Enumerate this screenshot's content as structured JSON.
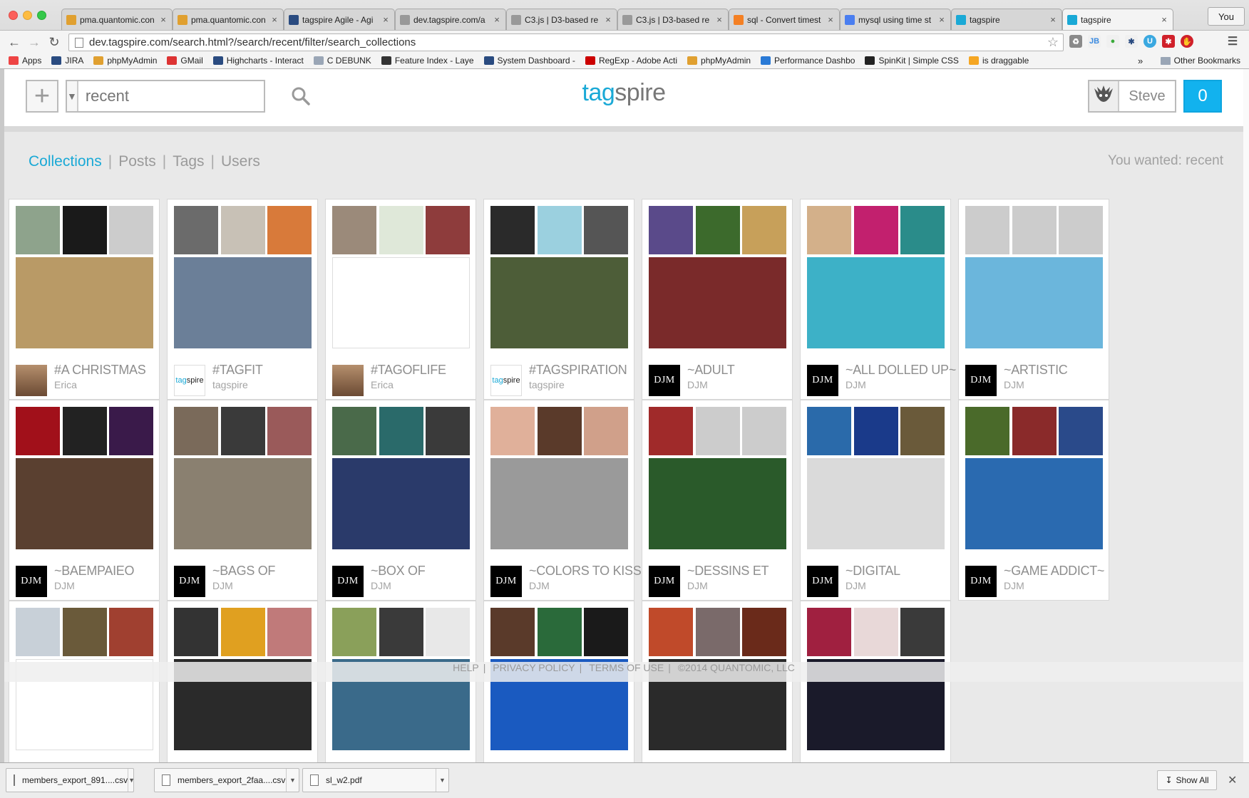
{
  "browser": {
    "tabs": [
      {
        "label": "pma.quantomic.con",
        "icon": "pma-icon",
        "color": "#e0a030"
      },
      {
        "label": "pma.quantomic.con",
        "icon": "pma-icon",
        "color": "#e0a030"
      },
      {
        "label": "tagspire Agile - Agi",
        "icon": "jira-icon",
        "color": "#2a4b80"
      },
      {
        "label": "dev.tagspire.com/a",
        "icon": "page-icon",
        "color": "#999999"
      },
      {
        "label": "C3.js | D3-based re",
        "icon": "page-icon",
        "color": "#999999"
      },
      {
        "label": "C3.js | D3-based re",
        "icon": "page-icon",
        "color": "#999999"
      },
      {
        "label": "sql - Convert timest",
        "icon": "stackoverflow-icon",
        "color": "#f48024"
      },
      {
        "label": "mysql using time st",
        "icon": "google-icon",
        "color": "#4a7ef0"
      },
      {
        "label": "tagspire",
        "icon": "tagspire-icon",
        "color": "#1aa9d6"
      },
      {
        "label": "tagspire",
        "icon": "tagspire-icon",
        "color": "#1aa9d6"
      }
    ],
    "profile": "You",
    "url": "dev.tagspire.com/search.html?/search/recent/filter/search_collections",
    "bookmarks": [
      {
        "label": "Apps",
        "color": "#e44"
      },
      {
        "label": "JIRA",
        "color": "#2a4b80"
      },
      {
        "label": "phpMyAdmin",
        "color": "#e0a030"
      },
      {
        "label": "GMail",
        "color": "#d33"
      },
      {
        "label": "Highcharts - Interact",
        "color": "#2a4b80"
      },
      {
        "label": "C DEBUNK",
        "color": "#9aa6b6"
      },
      {
        "label": "Feature Index - Laye",
        "color": "#333"
      },
      {
        "label": "System Dashboard -",
        "color": "#2a4b80"
      },
      {
        "label": "RegExp - Adobe Acti",
        "color": "#c00"
      },
      {
        "label": "phpMyAdmin",
        "color": "#e0a030"
      },
      {
        "label": "Performance Dashbo",
        "color": "#2a7ad6"
      },
      {
        "label": "SpinKit | Simple CSS",
        "color": "#222"
      },
      {
        "label": "is draggable",
        "color": "#f5a623"
      }
    ],
    "more_bookmarks": "»",
    "other_bookmarks": "Other Bookmarks"
  },
  "app": {
    "logo_part1": "tag",
    "logo_part2": "spire",
    "search_placeholder": "recent",
    "user_name": "Steve",
    "notification_count": "0",
    "filters": [
      "Collections",
      "Posts",
      "Tags",
      "Users"
    ],
    "active_filter": "Collections",
    "wanted_text": "You wanted: recent"
  },
  "collections": [
    {
      "title": "#A CHRISTMAS",
      "owner": "Erica",
      "avatar": "person",
      "colors": [
        "#8ea38c",
        "#1a1a1a",
        "#cccccc"
      ],
      "main": "#b99a66"
    },
    {
      "title": "#TAGFIT",
      "owner": "tagspire",
      "avatar": "tagspire",
      "colors": [
        "#6b6b6b",
        "#c8c1b6",
        "#d87a3a"
      ],
      "main": "#6b7f98"
    },
    {
      "title": "#TAGOFLIFE",
      "owner": "Erica",
      "avatar": "person",
      "colors": [
        "#9b8a7a",
        "#dfe8d9",
        "#8e3c3c"
      ],
      "main": "#ffffff"
    },
    {
      "title": "#TAGSPIRATION",
      "owner": "tagspire",
      "avatar": "tagspire",
      "colors": [
        "#2a2a2a",
        "#9bd0df",
        "#555555"
      ],
      "main": "#4d5d38"
    },
    {
      "title": "~ADULT",
      "owner": "DJM",
      "avatar": "djm",
      "colors": [
        "#5a4a8a",
        "#3c6a2c",
        "#c7a05a"
      ],
      "main": "#7a2a2a"
    },
    {
      "title": "~ALL DOLLED UP~",
      "owner": "DJM",
      "avatar": "djm",
      "colors": [
        "#d3b08a",
        "#c2206e",
        "#2a8c8a"
      ],
      "main": "#3db1c7"
    },
    {
      "title": "~ARTISTIC",
      "owner": "DJM",
      "avatar": "djm",
      "colors": [
        "#cccccc",
        "#cccccc",
        "#cccccc"
      ],
      "main": "#6bb6dc"
    },
    {
      "title": "~BAEMPAIEO",
      "owner": "DJM",
      "avatar": "djm",
      "colors": [
        "#a1101a",
        "#222222",
        "#3a1a4a"
      ],
      "main": "#5a4030"
    },
    {
      "title": "~BAGS OF",
      "owner": "DJM",
      "avatar": "djm",
      "colors": [
        "#7a6a5a",
        "#3a3a3a",
        "#9a5a5a"
      ],
      "main": "#8a8070"
    },
    {
      "title": "~BOX OF",
      "owner": "DJM",
      "avatar": "djm",
      "colors": [
        "#4a6a4a",
        "#2a6a6a",
        "#3a3a3a"
      ],
      "main": "#2a3a6a"
    },
    {
      "title": "~COLORS TO KISS",
      "owner": "DJM",
      "avatar": "djm",
      "colors": [
        "#e0b09a",
        "#5a3a2a",
        "#d0a08a"
      ],
      "main": "#9a9a9a"
    },
    {
      "title": "~DESSINS ET",
      "owner": "DJM",
      "avatar": "djm",
      "colors": [
        "#a02a2a",
        "#cccccc",
        "#cccccc"
      ],
      "main": "#2a5a2a"
    },
    {
      "title": "~DIGITAL",
      "owner": "DJM",
      "avatar": "djm",
      "colors": [
        "#2a6aaa",
        "#1a3a8a",
        "#6a5a3a"
      ],
      "main": "#dadada"
    },
    {
      "title": "~GAME ADDICT~",
      "owner": "DJM",
      "avatar": "djm",
      "colors": [
        "#4a6a2a",
        "#8a2a2a",
        "#2a4a8a"
      ],
      "main": "#2a6ab0"
    },
    {
      "title": "",
      "owner": "",
      "avatar": "",
      "colors": [
        "#c8d0d8",
        "#6a5a3a",
        "#a04030"
      ],
      "main": "#ffffff"
    },
    {
      "title": "",
      "owner": "",
      "avatar": "",
      "colors": [
        "#333333",
        "#e0a020",
        "#c07a7a"
      ],
      "main": "#2a2a2a"
    },
    {
      "title": "",
      "owner": "",
      "avatar": "",
      "colors": [
        "#8aa05a",
        "#3a3a3a",
        "#e8e8e8"
      ],
      "main": "#3a6a8a"
    },
    {
      "title": "",
      "owner": "",
      "avatar": "",
      "colors": [
        "#5a3a2a",
        "#2a6a3a",
        "#1a1a1a"
      ],
      "main": "#1a5ac0"
    },
    {
      "title": "",
      "owner": "",
      "avatar": "",
      "colors": [
        "#c04a2a",
        "#7a6a6a",
        "#6a2a1a"
      ],
      "main": "#2a2a2a"
    },
    {
      "title": "",
      "owner": "",
      "avatar": "",
      "colors": [
        "#a02040",
        "#e8d8d8",
        "#3a3a3a"
      ],
      "main": "#1a1a2a"
    }
  ],
  "footer": {
    "links": [
      "HELP",
      "PRIVACY POLICY",
      "TERMS OF USE"
    ],
    "copyright": "©2014 QUANTOMIC, LLC"
  },
  "downloads": {
    "items": [
      "members_export_891....csv",
      "members_export_2faa....csv",
      "sl_w2.pdf"
    ],
    "show_all": "Show All"
  }
}
